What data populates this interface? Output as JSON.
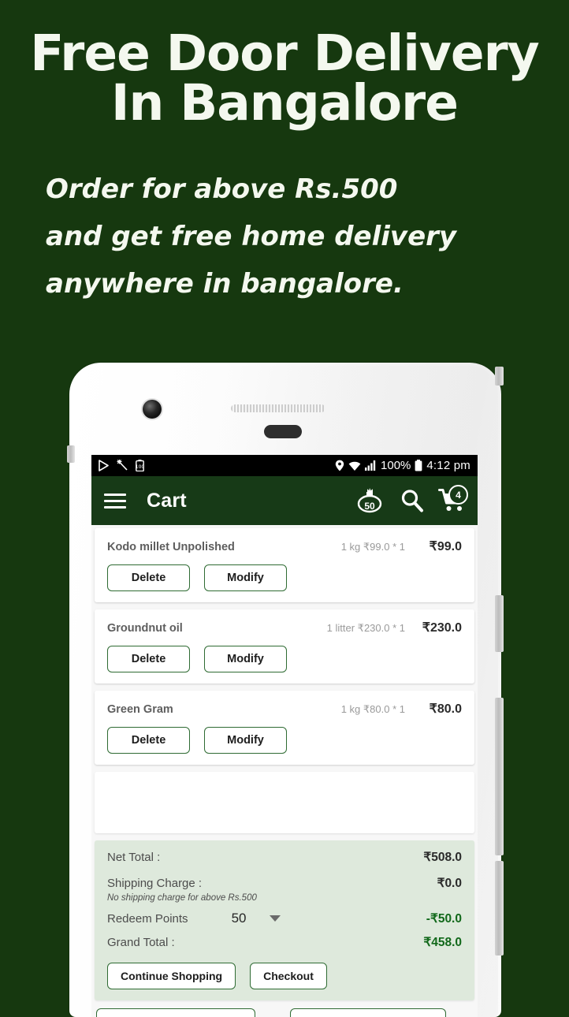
{
  "promo": {
    "title": "Free Door Delivery\nIn Bangalore",
    "subtitle": "Order  for above Rs.500\nand get free home delivery\nanywhere in bangalore."
  },
  "colors": {
    "background_green": "#16380f",
    "appbar_green": "#173a17",
    "accent_green": "#2f6b33",
    "totals_panel": "#dee9dc",
    "value_green": "#11681a"
  },
  "statusbar": {
    "battery_icon_label": "100",
    "location_icon": "location-pin-icon",
    "wifi_icon": "wifi-icon",
    "signal_icon": "signal-bars-icon",
    "battery_percent": "100%",
    "time": "4:12 pm"
  },
  "appbar": {
    "menu_icon": "hamburger-menu-icon",
    "title": "Cart",
    "reward_points": "50",
    "search_icon": "search-icon",
    "cart_icon": "shopping-cart-icon",
    "cart_badge": "4"
  },
  "cart": {
    "items": [
      {
        "name": "Kodo millet Unpolished",
        "qty": "1 kg ₹99.0 * 1",
        "price": "₹99.0",
        "delete_label": "Delete",
        "modify_label": "Modify"
      },
      {
        "name": "Groundnut oil",
        "qty": "1 litter ₹230.0 * 1",
        "price": "₹230.0",
        "delete_label": "Delete",
        "modify_label": "Modify"
      },
      {
        "name": "Green Gram",
        "qty": "1 kg ₹80.0 * 1",
        "price": "₹80.0",
        "delete_label": "Delete",
        "modify_label": "Modify"
      }
    ]
  },
  "totals": {
    "net_total_label": "Net Total :",
    "net_total_value": "₹508.0",
    "shipping_label": "Shipping Charge :",
    "shipping_value": "₹0.0",
    "shipping_note": "No shipping charge for above Rs.500",
    "redeem_label": "Redeem Points",
    "redeem_selected": "50",
    "redeem_value": "-₹50.0",
    "grand_total_label": "Grand Total :",
    "grand_total_value": "₹458.0",
    "continue_label": "Continue Shopping",
    "checkout_label": "Checkout"
  }
}
